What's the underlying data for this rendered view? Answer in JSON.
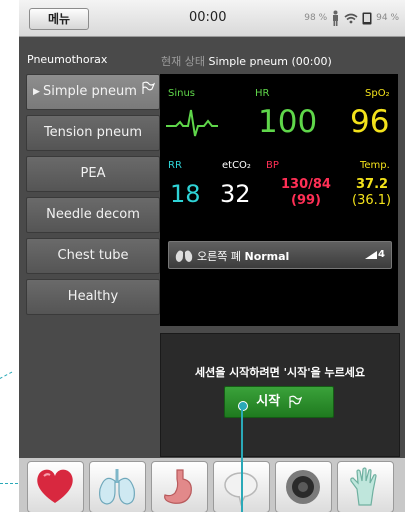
{
  "statusbar": {
    "menu_label": "메뉴",
    "clock": "00:00",
    "battery_left": "98 %",
    "battery_right": "94 %"
  },
  "left": {
    "case_title": "Pneumothorax",
    "scenarios": [
      {
        "label": "Simple pneum",
        "active": true
      },
      {
        "label": "Tension pneum"
      },
      {
        "label": "PEA"
      },
      {
        "label": "Needle decom"
      },
      {
        "label": "Chest tube"
      },
      {
        "label": "Healthy"
      }
    ]
  },
  "state": {
    "prefix": "현재 상태",
    "value": "Simple pneum (00:00)"
  },
  "monitor": {
    "sinus_label": "Sinus",
    "hr_label": "HR",
    "hr_value": "100",
    "spo2_label": "SpO₂",
    "spo2_value": "96",
    "rr_label": "RR",
    "rr_value": "18",
    "etco2_label": "etCO₂",
    "etco2_value": "32",
    "bp_label": "BP",
    "bp_value": "130/84",
    "bp_mean": "(99)",
    "temp_label": "Temp.",
    "temp_value": "37.2",
    "temp_secondary": "(36.1)",
    "lung_prefix": "오른쪽 폐",
    "lung_status": "Normal",
    "lung_signal": "4"
  },
  "dialog": {
    "message": "세션을 시작하려면 '시작'을 누르세요",
    "start_label": "시작"
  },
  "tray": {
    "items": [
      "heart-icon",
      "lungs-icon",
      "stomach-icon",
      "speech-icon",
      "speaker-icon",
      "glove-icon"
    ]
  },
  "colors": {
    "hr": "#5fd64a",
    "spo2": "#f3e21b",
    "rr": "#2fd3d6",
    "bp": "#ff2f55",
    "start_button": "#2e8f2e",
    "callout": "#2aa9b8"
  }
}
